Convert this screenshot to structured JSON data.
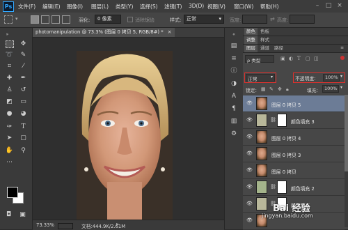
{
  "app": {
    "logo": "Ps"
  },
  "menu": [
    "文件(F)",
    "编辑(E)",
    "图像(I)",
    "图层(L)",
    "类型(Y)",
    "选择(S)",
    "滤镜(T)",
    "3D(D)",
    "视图(V)",
    "窗口(W)",
    "帮助(H)"
  ],
  "options": {
    "feather_label": "羽化:",
    "feather_value": "0 像素",
    "antialias_label": "消除锯齿",
    "style_label": "样式:",
    "style_value": "正常",
    "width_label": "宽度:",
    "height_label": "高度:"
  },
  "document": {
    "tab_title": "photomanipulation @ 73.3% (图层 0 拷贝 5, RGB/8#) *",
    "tab_close": "×",
    "zoom": "73.33%",
    "doc_size": "文档:444.9K/2.61M"
  },
  "panels": {
    "top_tabs": [
      "颜色",
      "色板"
    ],
    "mid_tabs": [
      "调整",
      "样式"
    ],
    "layer_tabs": [
      "图层",
      "通道",
      "路径"
    ],
    "filter_kind": "ρ 类型",
    "blend_mode": "正常",
    "opacity_label": "不透明度:",
    "opacity_value": "100%",
    "lock_label": "锁定:",
    "fill_label": "填充:",
    "fill_value": "100%"
  },
  "layers": [
    {
      "name": "图层 0 拷贝 5",
      "type": "face",
      "selected": true,
      "has_mask": false
    },
    {
      "name": "颜色填充 3",
      "type": "fill",
      "selected": false,
      "has_mask": true
    },
    {
      "name": "图层 0 拷贝 4",
      "type": "face",
      "selected": false,
      "has_mask": false
    },
    {
      "name": "图层 0 拷贝 3",
      "type": "face",
      "selected": false,
      "has_mask": false
    },
    {
      "name": "图层 0 拷贝",
      "type": "face",
      "selected": false,
      "has_mask": false
    },
    {
      "name": "颜色填充 2",
      "type": "fill-green",
      "selected": false,
      "has_mask": true
    },
    {
      "name": "颜色填充",
      "type": "fill",
      "selected": false,
      "has_mask": true
    }
  ],
  "watermark": {
    "brand": "Bai 经验",
    "url": "jingyan.baidu.com"
  },
  "colors": {
    "foreground": "#000000",
    "background": "#ffffff",
    "selected_layer": "#6c7c96",
    "highlight": "#e0302c"
  }
}
